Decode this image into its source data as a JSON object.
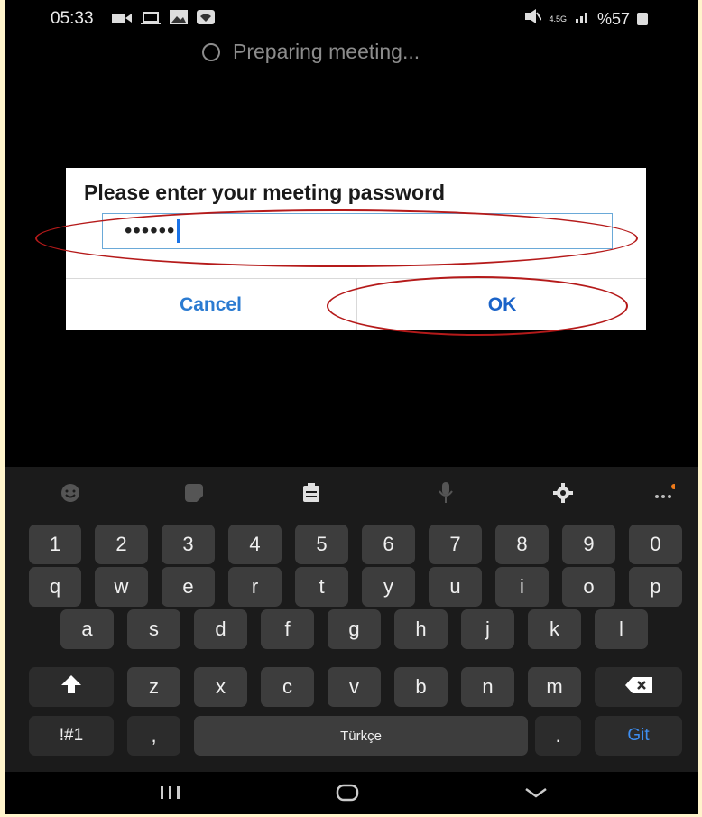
{
  "status_bar": {
    "time": "05:33",
    "network": "4.5G",
    "battery": "%57"
  },
  "loading_text": "Preparing meeting...",
  "dialog": {
    "title": "Please enter your meeting password",
    "password_value": "••••••",
    "cancel_label": "Cancel",
    "ok_label": "OK"
  },
  "keyboard": {
    "toolbar_icons": [
      "emoji-icon",
      "sticker-icon",
      "clipboard-icon",
      "microphone-icon",
      "settings-icon",
      "more-icon"
    ],
    "row_numbers": [
      "1",
      "2",
      "3",
      "4",
      "5",
      "6",
      "7",
      "8",
      "9",
      "0"
    ],
    "row_top": [
      "q",
      "w",
      "e",
      "r",
      "t",
      "y",
      "u",
      "i",
      "o",
      "p"
    ],
    "row_middle": [
      "a",
      "s",
      "d",
      "f",
      "g",
      "h",
      "j",
      "k",
      "l"
    ],
    "row_bottom": [
      "z",
      "x",
      "c",
      "v",
      "b",
      "n",
      "m"
    ],
    "symbols_label": "!#1",
    "comma_label": ",",
    "space_label": "Türkçe",
    "period_label": ".",
    "go_label": "Git"
  },
  "colors": {
    "accent": "#2b7bd1",
    "annotation": "#b51a1a",
    "keyboard_bg": "#1b1b1b",
    "key_bg": "#3d3d3d"
  }
}
